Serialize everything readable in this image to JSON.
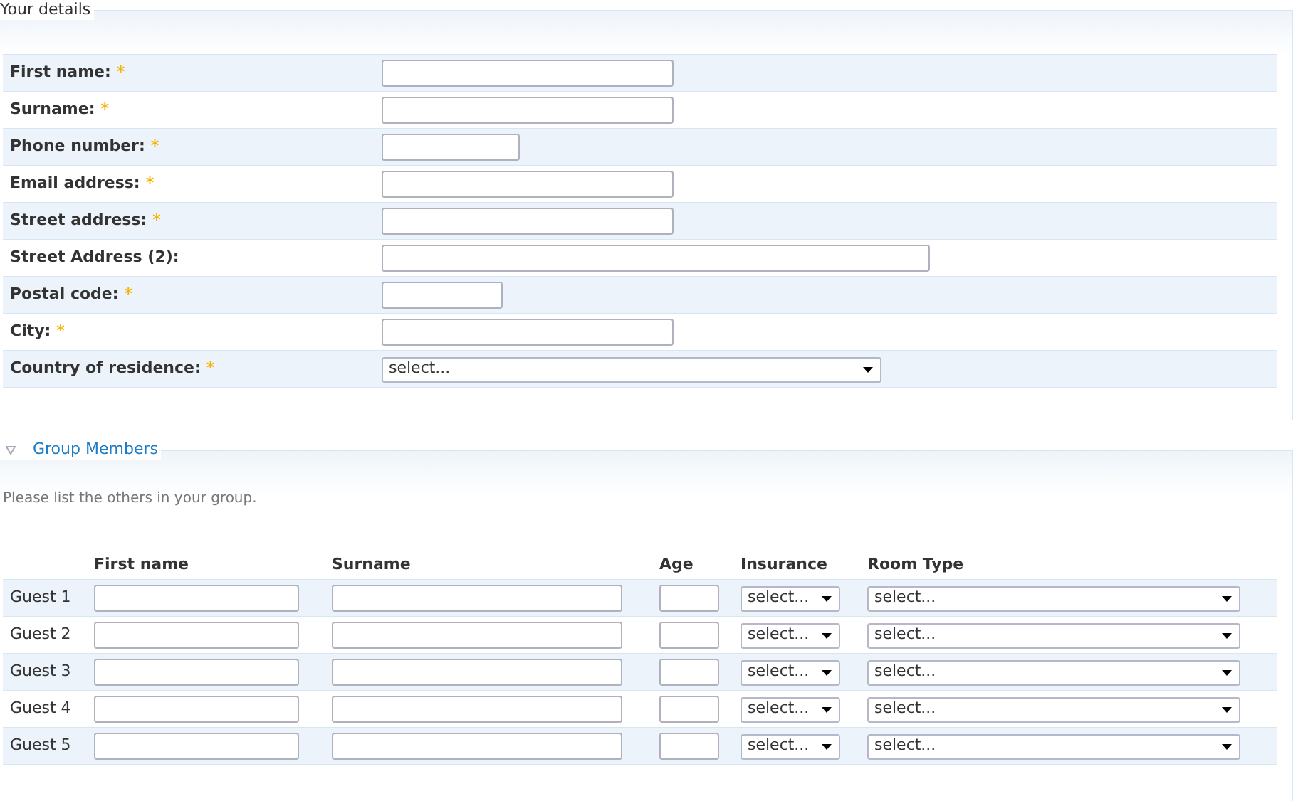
{
  "required_mark": "*",
  "details": {
    "legend": "Your details",
    "fields": [
      {
        "label": "First name:",
        "required": true,
        "kind": "text"
      },
      {
        "label": "Surname:",
        "required": true,
        "kind": "text"
      },
      {
        "label": "Phone number:",
        "required": true,
        "kind": "short"
      },
      {
        "label": "Email address:",
        "required": true,
        "kind": "text"
      },
      {
        "label": "Street address:",
        "required": true,
        "kind": "text"
      },
      {
        "label": "Street Address (2):",
        "required": false,
        "kind": "long"
      },
      {
        "label": "Postal code:",
        "required": true,
        "kind": "tiny"
      },
      {
        "label": "City:",
        "required": true,
        "kind": "text"
      },
      {
        "label": "Country of residence:",
        "required": true,
        "kind": "select",
        "value": "select..."
      }
    ]
  },
  "group": {
    "legend": "Group Members",
    "expanded": true,
    "note": "Please list the others in your group.",
    "columns": [
      "First name",
      "Surname",
      "Age",
      "Insurance",
      "Room Type"
    ],
    "rows": [
      {
        "label": "Guest 1",
        "insurance": "select...",
        "room_type": "select..."
      },
      {
        "label": "Guest 2",
        "insurance": "select...",
        "room_type": "select..."
      },
      {
        "label": "Guest 3",
        "insurance": "select...",
        "room_type": "select..."
      },
      {
        "label": "Guest 4",
        "insurance": "select...",
        "room_type": "select..."
      },
      {
        "label": "Guest 5",
        "insurance": "select...",
        "room_type": "select..."
      }
    ]
  }
}
